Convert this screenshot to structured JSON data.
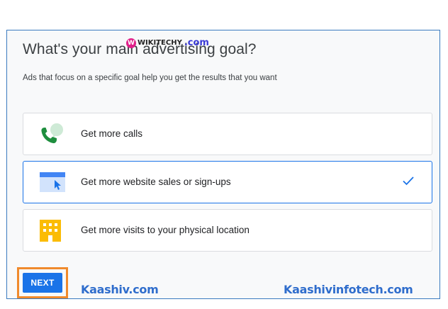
{
  "page": {
    "title": "What's your main advertising goal?",
    "subtitle": "Ads that focus on a specific goal help you get the results that you want"
  },
  "options": [
    {
      "label": "Get more calls",
      "icon": "phone-call-icon",
      "selected": false
    },
    {
      "label": "Get more website sales or sign-ups",
      "icon": "website-cursor-icon",
      "selected": true
    },
    {
      "label": "Get more visits to your physical location",
      "icon": "building-icon",
      "selected": false
    }
  ],
  "next_button": {
    "label": "NEXT"
  },
  "watermarks": {
    "top_brand": "WIKITECHY",
    "top_suffix": ".com",
    "left": "Kaashiv.com",
    "right": "Kaashivinfotech.com"
  },
  "colors": {
    "accent": "#1a73e8",
    "highlight_box": "#f08a2c",
    "frame_border": "#3b7bbf",
    "watermark": "#2f6dcc"
  }
}
